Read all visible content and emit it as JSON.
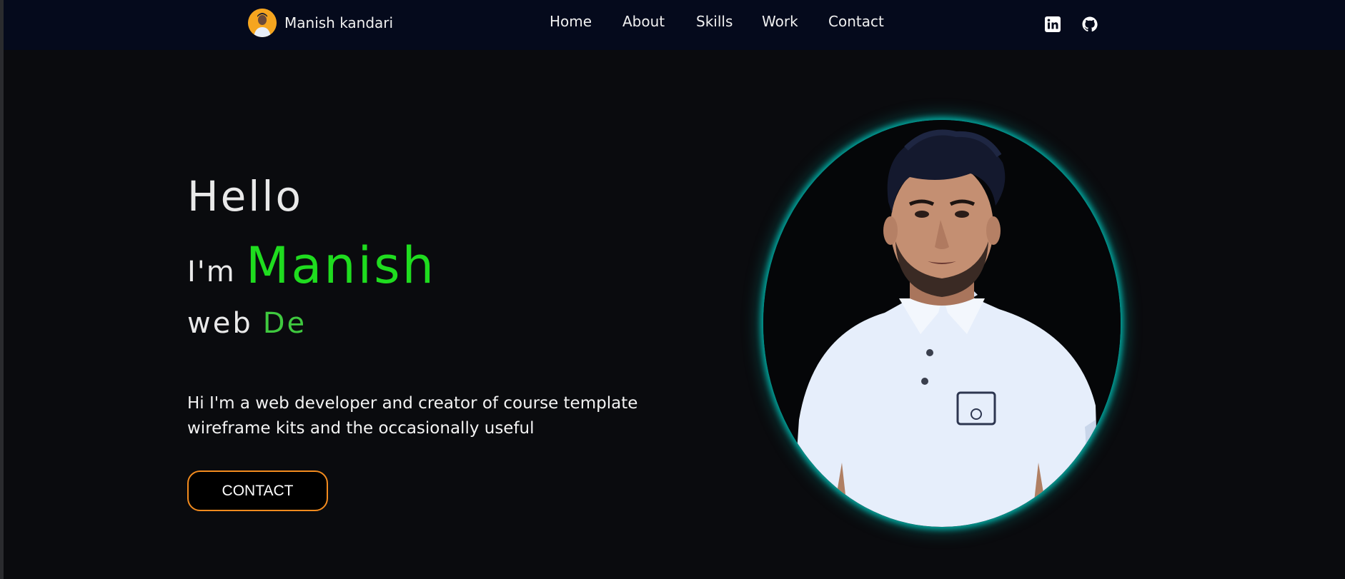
{
  "nav": {
    "brand_name": "Manish kandari",
    "links": [
      "Home",
      "About",
      "Skills",
      "Work",
      "Contact"
    ],
    "social_icons": [
      "linkedin-icon",
      "github-icon"
    ]
  },
  "hero": {
    "greeting": "Hello",
    "iam": "I'm",
    "name": "Manish",
    "role_static": "web",
    "role_typed": "De",
    "description": "Hi I'm a web developer and creator of course template wireframe kits and the occasionally useful",
    "cta_label": "CONTACT",
    "portrait": "profile-photo"
  },
  "colors": {
    "nav_bg": "#050a1c",
    "page_bg": "#0a0b0e",
    "accent_green": "#1fdc1f",
    "button_border": "#f28b1e",
    "portrait_glow": "#00c8be"
  }
}
